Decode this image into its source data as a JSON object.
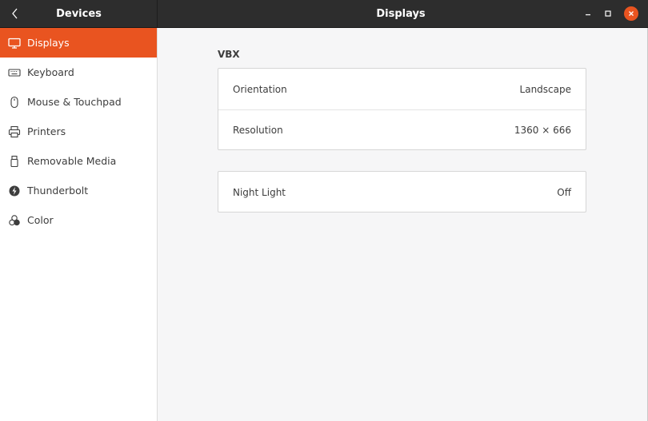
{
  "header": {
    "left_title": "Devices",
    "title": "Displays"
  },
  "sidebar": {
    "items": [
      {
        "label": "Displays",
        "icon": "display-icon",
        "active": true
      },
      {
        "label": "Keyboard",
        "icon": "keyboard-icon"
      },
      {
        "label": "Mouse & Touchpad",
        "icon": "mouse-icon"
      },
      {
        "label": "Printers",
        "icon": "printer-icon"
      },
      {
        "label": "Removable Media",
        "icon": "removable-media-icon"
      },
      {
        "label": "Thunderbolt",
        "icon": "thunderbolt-icon"
      },
      {
        "label": "Color",
        "icon": "color-icon"
      }
    ]
  },
  "main": {
    "section_title": "VBX",
    "display_settings": [
      {
        "label": "Orientation",
        "value": "Landscape"
      },
      {
        "label": "Resolution",
        "value": "1360 × 666"
      }
    ],
    "night_light": {
      "label": "Night Light",
      "value": "Off"
    }
  },
  "colors": {
    "accent": "#e95420",
    "header_bg": "#2d2d2d",
    "content_bg": "#f6f6f7"
  }
}
